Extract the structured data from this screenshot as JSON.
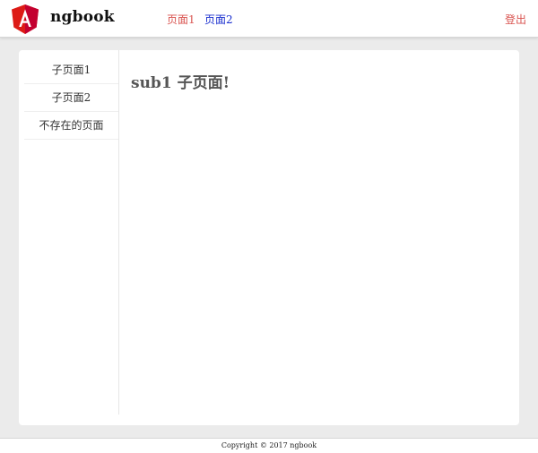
{
  "header": {
    "brand": "ngbook",
    "logo_letter": "A",
    "logo_color": "#dd1b16",
    "logo_dark_color": "#c3002f",
    "nav": [
      {
        "label": "页面1",
        "color": "#d9534f"
      },
      {
        "label": "页面2",
        "color": "#1a2fcf"
      }
    ],
    "logout_label": "登出"
  },
  "sidebar": {
    "items": [
      {
        "label": "子页面1"
      },
      {
        "label": "子页面2"
      },
      {
        "label": "不存在的页面"
      }
    ]
  },
  "main": {
    "title": "sub1 子页面!"
  },
  "footer": {
    "text": "Copyright © 2017 ngbook"
  }
}
